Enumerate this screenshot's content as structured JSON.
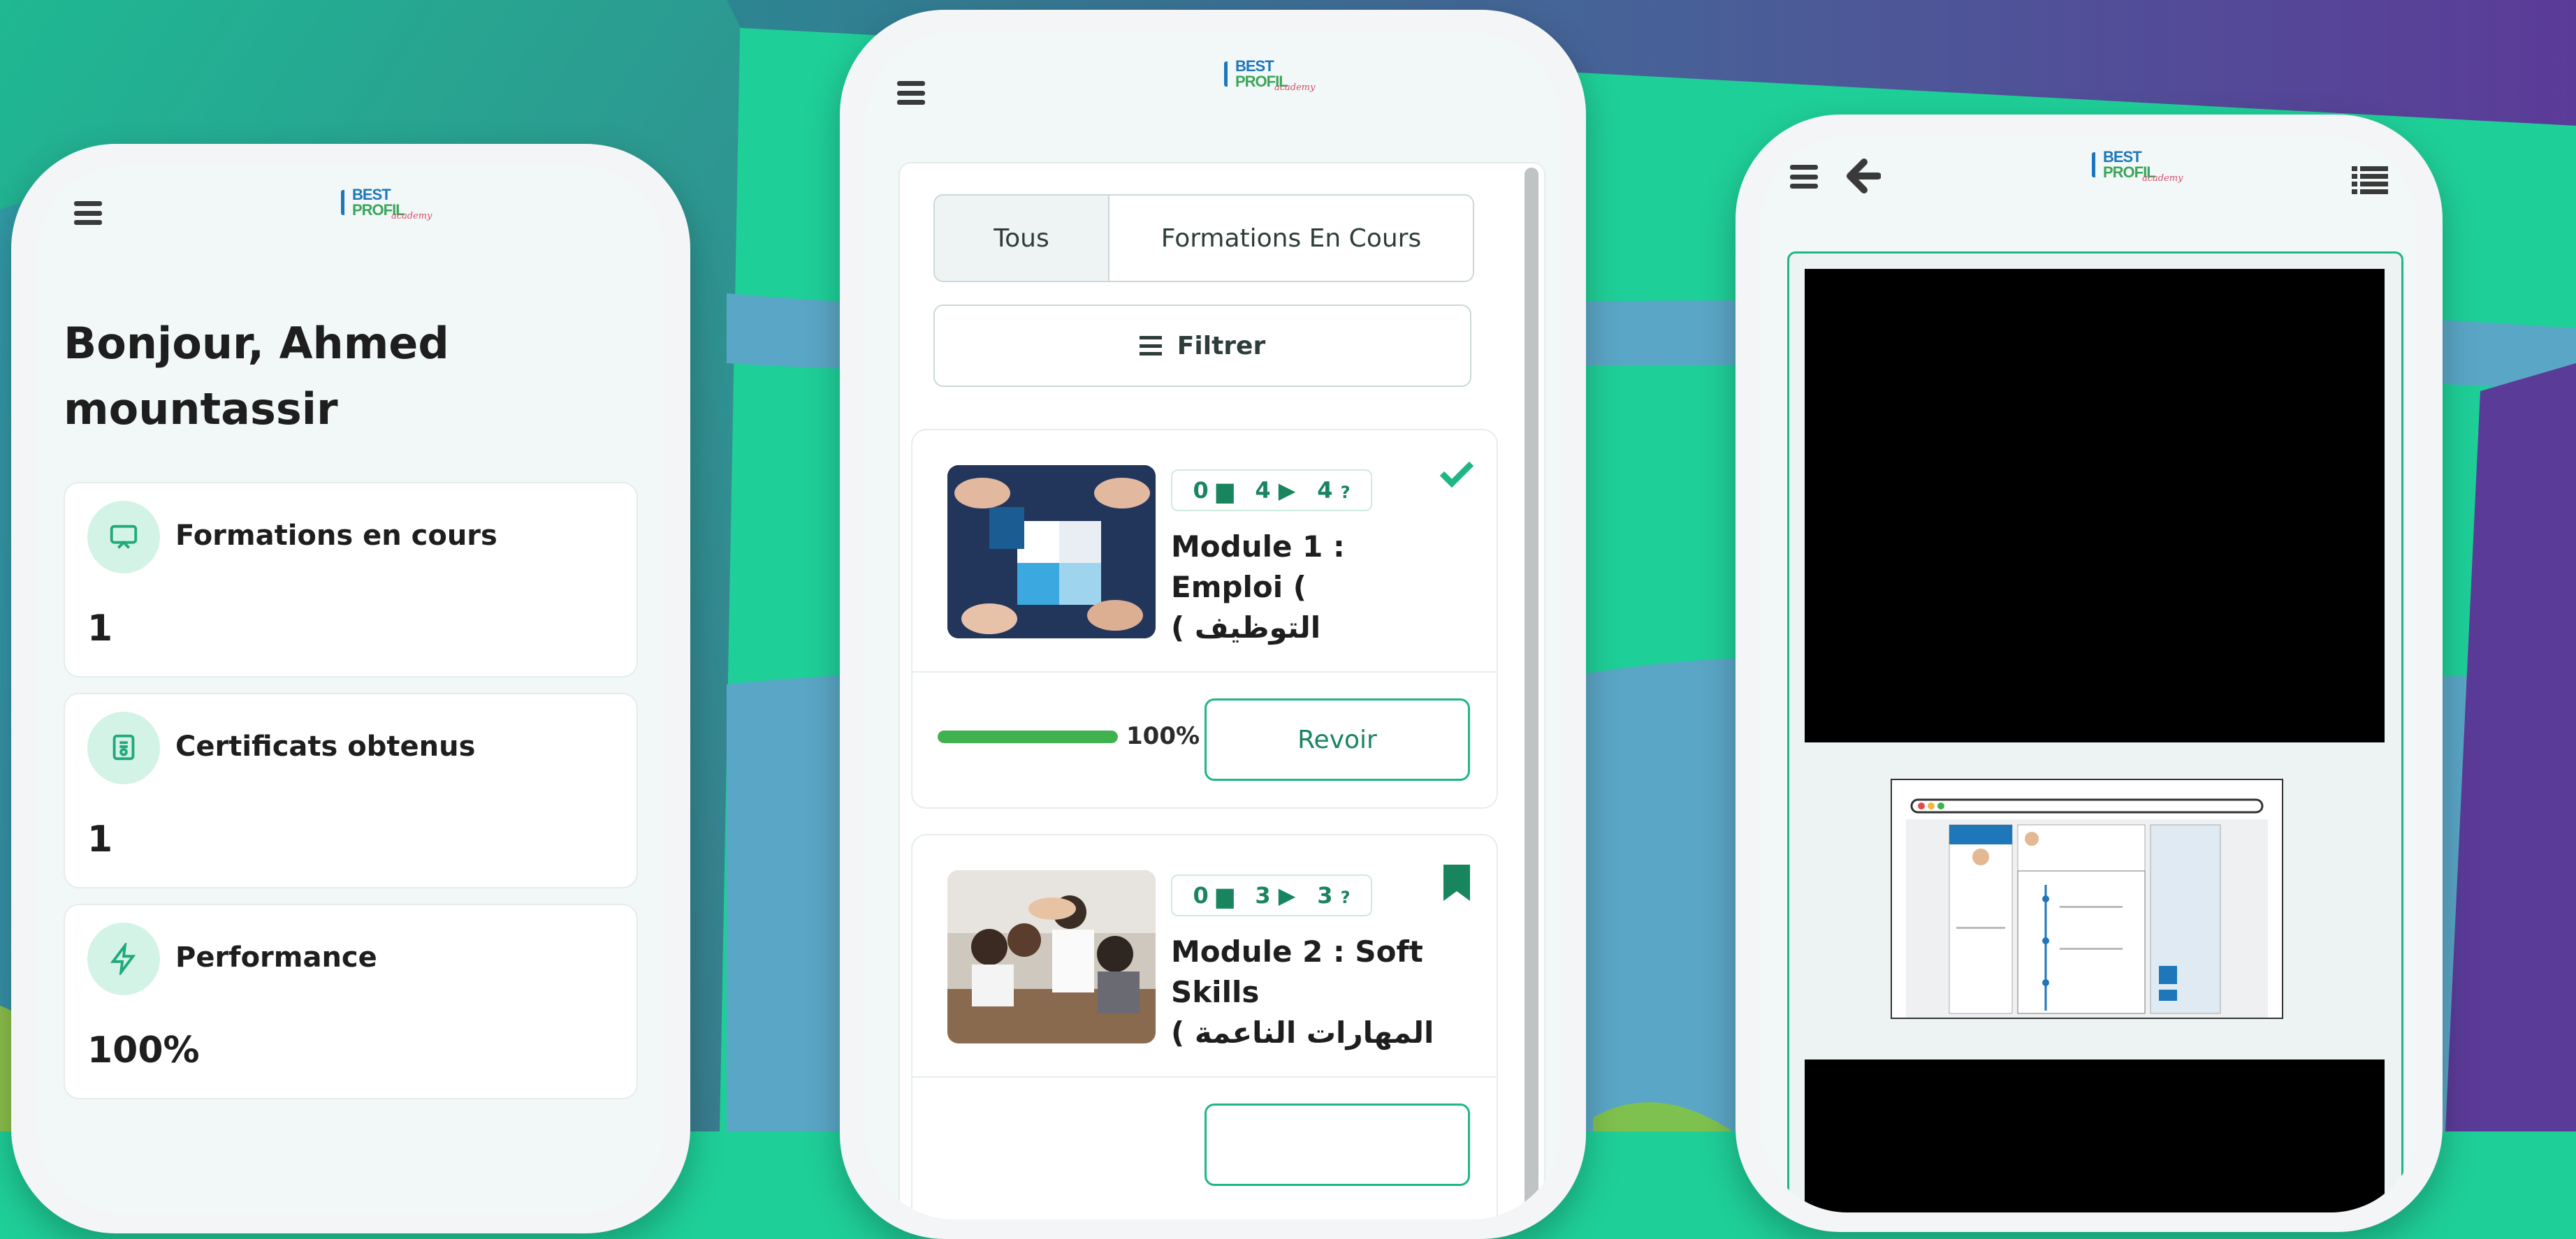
{
  "phone1": {
    "greeting": "Bonjour, Ahmed mountassir",
    "stats": [
      {
        "title": "Formations en cours",
        "value": "1",
        "icon": "presentation-icon"
      },
      {
        "title": "Certificats obtenus",
        "value": "1",
        "icon": "certificate-icon"
      },
      {
        "title": "Performance",
        "value": "100%",
        "icon": "lightning-icon"
      }
    ]
  },
  "logo": {
    "line1": "BEST",
    "line2": "PROFIL",
    "line3": "academy"
  },
  "phone2": {
    "tabs": [
      {
        "label": "Tous",
        "active": true
      },
      {
        "label": "Formations En Cours",
        "active": false
      }
    ],
    "filter_label": "Filtrer",
    "modules": [
      {
        "docs": "0",
        "videos": "4",
        "quizzes": "4",
        "title": "Module 1 : Emploi ( التوظيف )",
        "title_line1": "Module 1 : Emploi (",
        "title_line2": "( التوظيف",
        "status_icon": "check-icon",
        "progress": 1.0,
        "progress_label": "100%",
        "action_label": "Revoir"
      },
      {
        "docs": "0",
        "videos": "3",
        "quizzes": "3",
        "title": "Module 2 : Soft Skills ( المهارات الناعمة )",
        "title_line1": "Module 2 : Soft Skills",
        "title_line2": "( المهارات الناعمة",
        "status_icon": "bookmark-icon"
      }
    ]
  },
  "colors": {
    "accent": "#1fb686",
    "accent_dark": "#18855e",
    "progress_fill": "#3fb24f",
    "brand_blue": "#1d77b9"
  }
}
